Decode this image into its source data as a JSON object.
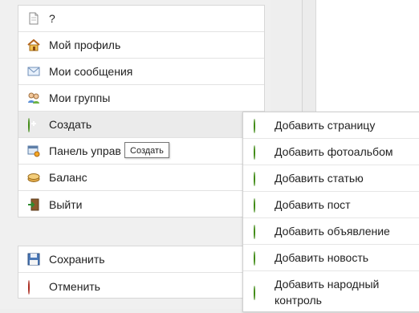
{
  "main_menu": {
    "items": [
      {
        "label": "?",
        "icon": "page-icon"
      },
      {
        "label": "Мой профиль",
        "icon": "home-icon"
      },
      {
        "label": "Мои сообщения",
        "icon": "envelope-icon"
      },
      {
        "label": "Мои группы",
        "icon": "users-icon"
      },
      {
        "label": "Создать",
        "icon": "plus-circle-icon"
      },
      {
        "label": "Панель управ",
        "icon": "control-panel-icon"
      },
      {
        "label": "Баланс",
        "icon": "coins-icon"
      },
      {
        "label": "Выйти",
        "icon": "exit-door-icon"
      }
    ]
  },
  "actions_menu": {
    "items": [
      {
        "label": "Сохранить",
        "icon": "floppy-disk-icon"
      },
      {
        "label": "Отменить",
        "icon": "cancel-circle-icon"
      }
    ]
  },
  "submenu": {
    "items": [
      {
        "label": "Добавить страницу"
      },
      {
        "label": "Добавить фотоальбом"
      },
      {
        "label": "Добавить статью"
      },
      {
        "label": "Добавить пост"
      },
      {
        "label": "Добавить объявление"
      },
      {
        "label": "Добавить новость"
      },
      {
        "label": "Добавить народный контроль"
      }
    ]
  },
  "tooltip": {
    "text": "Создать"
  },
  "colors": {
    "accent_green": "#4e9f1c",
    "cancel_red": "#c8281a",
    "active_row": "#ebebeb"
  }
}
